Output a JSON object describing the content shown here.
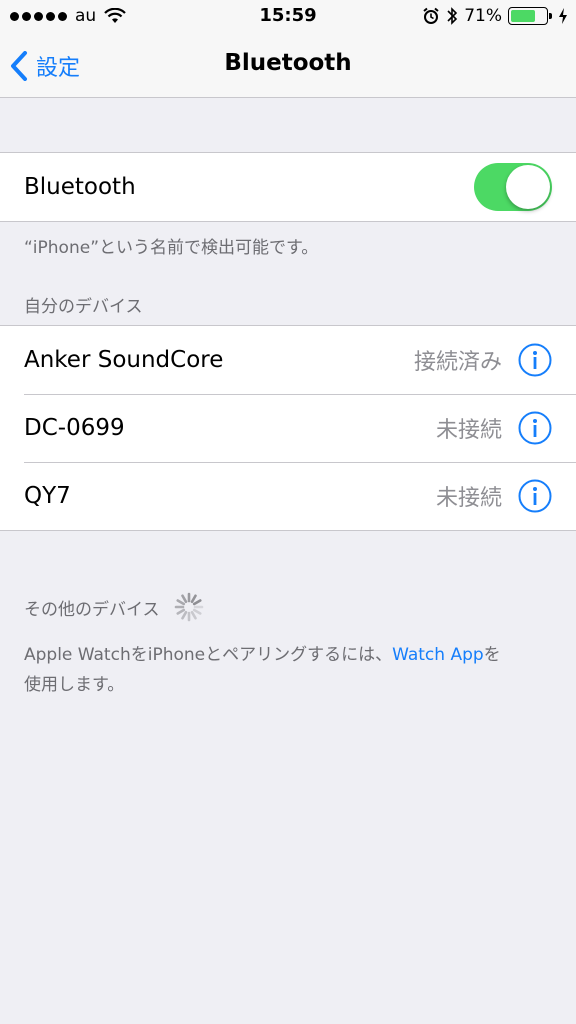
{
  "status_bar": {
    "carrier": "au",
    "time": "15:59",
    "battery_percent": "71%",
    "battery_level": 0.71,
    "battery_color": "#4cd964"
  },
  "nav": {
    "back_label": "設定",
    "title": "Bluetooth"
  },
  "bluetooth_toggle": {
    "label": "Bluetooth",
    "on": true,
    "on_color": "#4cd964"
  },
  "discoverable_note": "“iPhone”という名前で検出可能です。",
  "my_devices": {
    "header": "自分のデバイス",
    "items": [
      {
        "name": "Anker SoundCore",
        "status": "接続済み",
        "icon": "info-icon"
      },
      {
        "name": "DC-0699",
        "status": "未接続",
        "icon": "info-icon"
      },
      {
        "name": "QY7",
        "status": "未接続",
        "icon": "info-icon"
      }
    ]
  },
  "other_devices": {
    "header": "その他のデバイス",
    "spinner_icon": "loading-spinner-icon"
  },
  "watch_note": {
    "prefix": "Apple WatchをiPhoneとペアリングするには、",
    "link": "Watch App",
    "suffix": "を",
    "line2": "使用します。"
  },
  "colors": {
    "accent": "#157efb",
    "background": "#efeff4"
  }
}
